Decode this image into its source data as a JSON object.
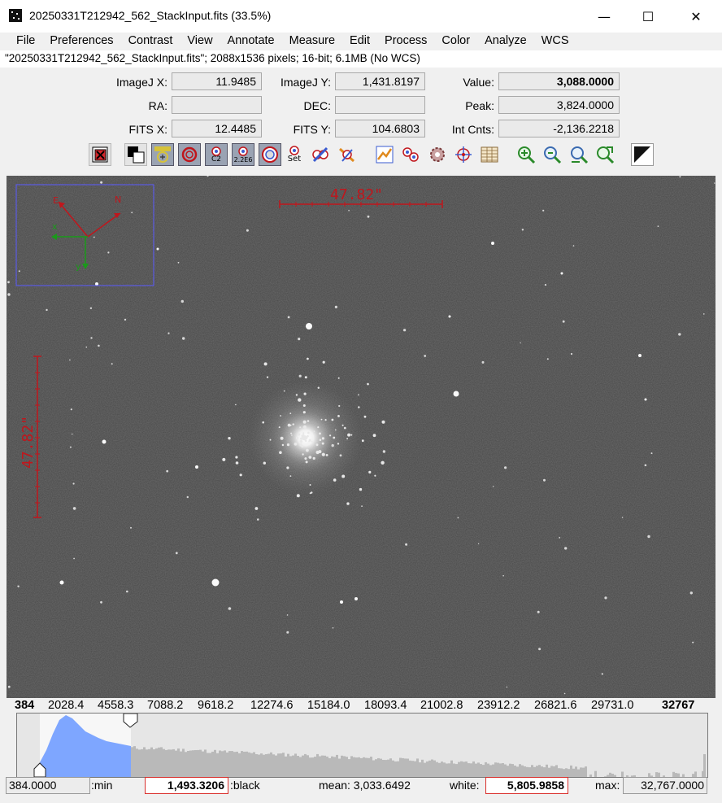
{
  "window": {
    "title": "20250331T212942_562_StackInput.fits (33.5%)",
    "minimize": "—",
    "maximize": "☐",
    "close": "✕"
  },
  "menu": [
    "File",
    "Preferences",
    "Contrast",
    "View",
    "Annotate",
    "Measure",
    "Edit",
    "Process",
    "Color",
    "Analyze",
    "WCS"
  ],
  "info_line": "\"20250331T212942_562_StackInput.fits\"; 2088x1536 pixels; 16-bit; 6.1MB (No WCS)",
  "readouts": {
    "imagej_x_label": "ImageJ X:",
    "imagej_x": "11.9485",
    "imagej_y_label": "ImageJ Y:",
    "imagej_y": "1,431.8197",
    "value_label": "Value:",
    "value": "3,088.0000",
    "ra_label": "RA:",
    "ra": "",
    "dec_label": "DEC:",
    "dec": "",
    "peak_label": "Peak:",
    "peak": "3,824.0000",
    "fits_x_label": "FITS X:",
    "fits_x": "12.4485",
    "fits_y_label": "FITS Y:",
    "fits_y": "104.6803",
    "int_cnts_label": "Int Cnts:",
    "int_cnts": "-2,136.2218"
  },
  "toolbar": {
    "tools": [
      "close-image-icon",
      "invert-icon",
      "name-aperture-icon",
      "aperture-icon",
      "c2-aperture-icon",
      "centroid-aperture-icon",
      "annulus-icon",
      "set-aperture-icon",
      "clear-apertures-icon",
      "clear-overlay-icon",
      "plot-icon",
      "multi-aperture-icon",
      "gear-aperture-icon",
      "target-icon",
      "table-icon",
      "zoom-in-icon",
      "zoom-in-alt-icon",
      "zoom-out-icon",
      "zoom-fit-icon",
      "contrast-icon"
    ],
    "c2_label": "C2",
    "c2e6_label": "2.2E6",
    "set_label": "Set"
  },
  "overlay": {
    "scale_horizontal": "47.82\"",
    "scale_vertical": "47.82\"",
    "compass_east": "E",
    "compass_north": "N",
    "compass_x": "x",
    "compass_y": "y"
  },
  "histogram_axis": [
    "384",
    "2028.4",
    "4558.3",
    "7088.2",
    "9618.2",
    "12274.6",
    "15184.0",
    "18093.4",
    "21002.8",
    "23912.2",
    "26821.6",
    "29731.0",
    "32767"
  ],
  "bottom": {
    "min_value": "384.0000",
    "min_label": ":min",
    "black_value": "1,493.3206",
    "black_label": ":black",
    "mean_text": "mean: 3,033.6492",
    "white_label": "white:",
    "white_value": "5,805.9858",
    "max_label": "max:",
    "max_value": "32,767.0000"
  },
  "colors": {
    "overlay_red": "#c0161c",
    "overlay_green": "#1a9a1a",
    "overlay_blue": "#5a5aff",
    "histogram_selected": "#7ea6ff",
    "histogram_bars": "#b9b9b9"
  }
}
